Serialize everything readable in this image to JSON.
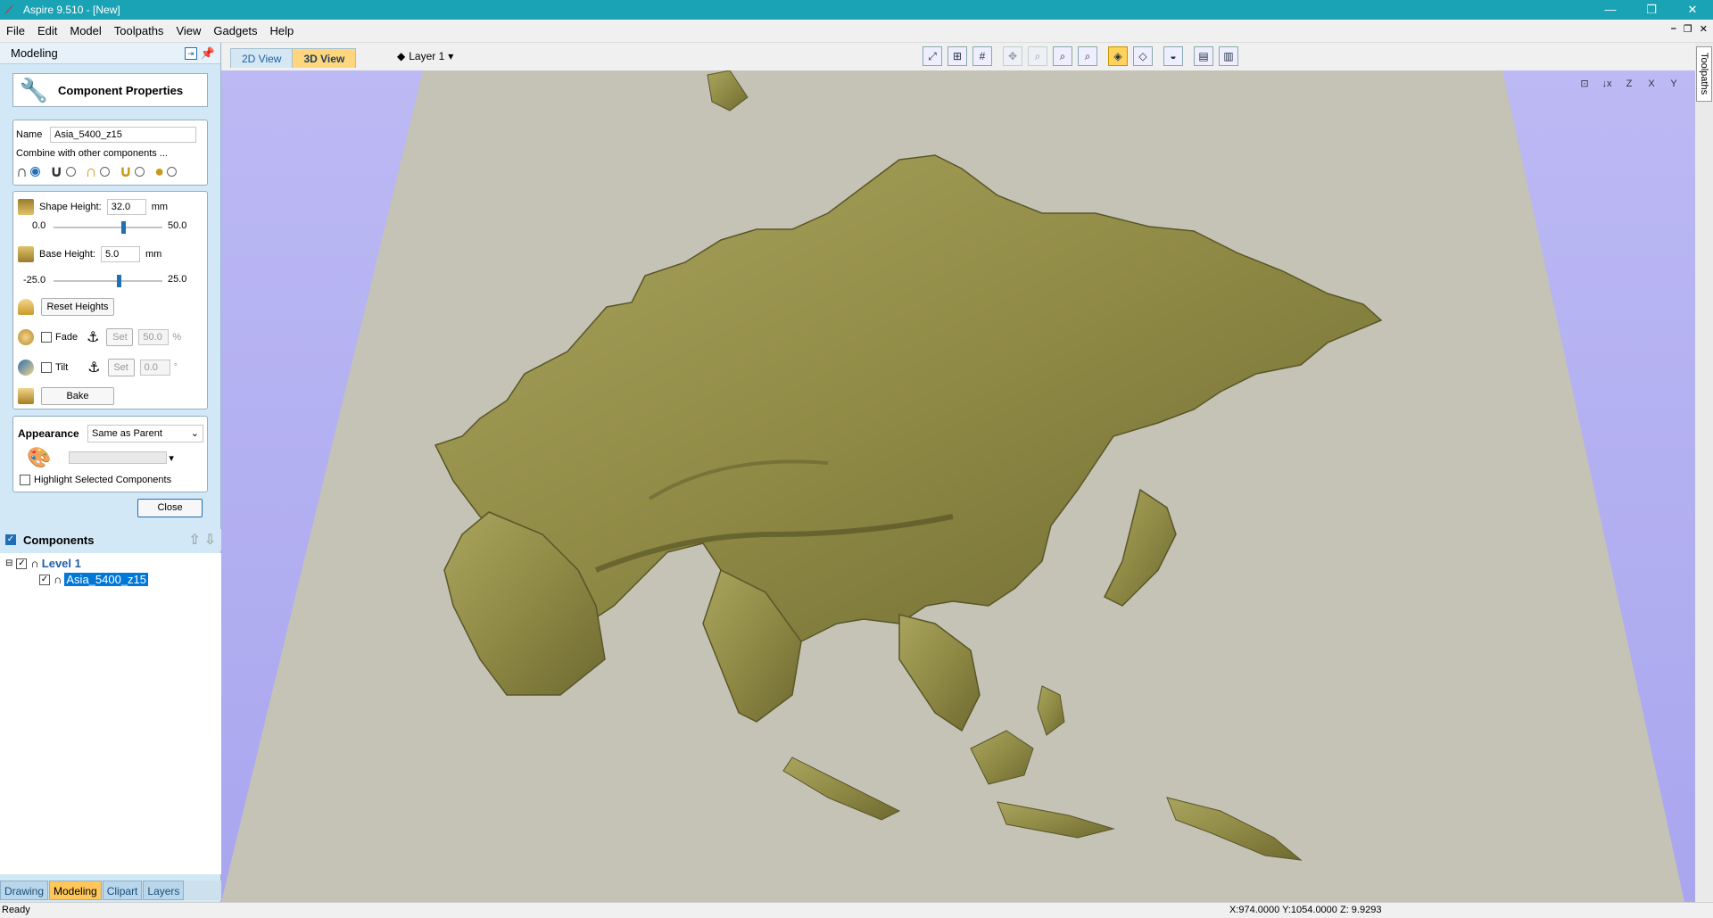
{
  "window": {
    "title": "Aspire 9.510 - [New]"
  },
  "menu": [
    "File",
    "Edit",
    "Model",
    "Toolpaths",
    "View",
    "Gadgets",
    "Help"
  ],
  "panel": {
    "header": "Modeling",
    "title": "Component Properties",
    "name_label": "Name",
    "name_value": "Asia_5400_z15",
    "combine_label": "Combine with other components ...",
    "shape_height_label": "Shape Height:",
    "shape_height_value": "32.0",
    "shape_height_unit": "mm",
    "shape_min": "0.0",
    "shape_max": "50.0",
    "shape_level": 0.64,
    "base_height_label": "Base Height:",
    "base_height_value": "5.0",
    "base_height_unit": "mm",
    "base_min": "-25.0",
    "base_max": "25.0",
    "base_level": 0.6,
    "reset_label": "Reset Heights",
    "fade_label": "Fade",
    "fade_set": "Set",
    "fade_value": "50.0",
    "fade_unit": "%",
    "tilt_label": "Tilt",
    "tilt_set": "Set",
    "tilt_value": "0.0",
    "tilt_unit": "°",
    "bake_label": "Bake",
    "appearance_label": "Appearance",
    "appearance_value": "Same as Parent",
    "highlight_label": "Highlight Selected Components",
    "close_label": "Close"
  },
  "components": {
    "title": "Components",
    "level": "Level 1",
    "item": "Asia_5400_z15"
  },
  "bottom_tabs": [
    "Drawing",
    "Modeling",
    "Clipart",
    "Layers"
  ],
  "view_tabs": [
    "2D View",
    "3D View"
  ],
  "layer": "Layer 1",
  "right_tab": "Toolpaths",
  "status": {
    "left": "Ready",
    "right": "X:974.0000 Y:1054.0000 Z:  9.9293"
  },
  "colors": {
    "titlebar": "#1aa3b5",
    "panel": "#d3e8f6",
    "viewport_bg": "#b1aef1",
    "plane": "#c4c3b6",
    "terrain": "#8f8a45"
  }
}
